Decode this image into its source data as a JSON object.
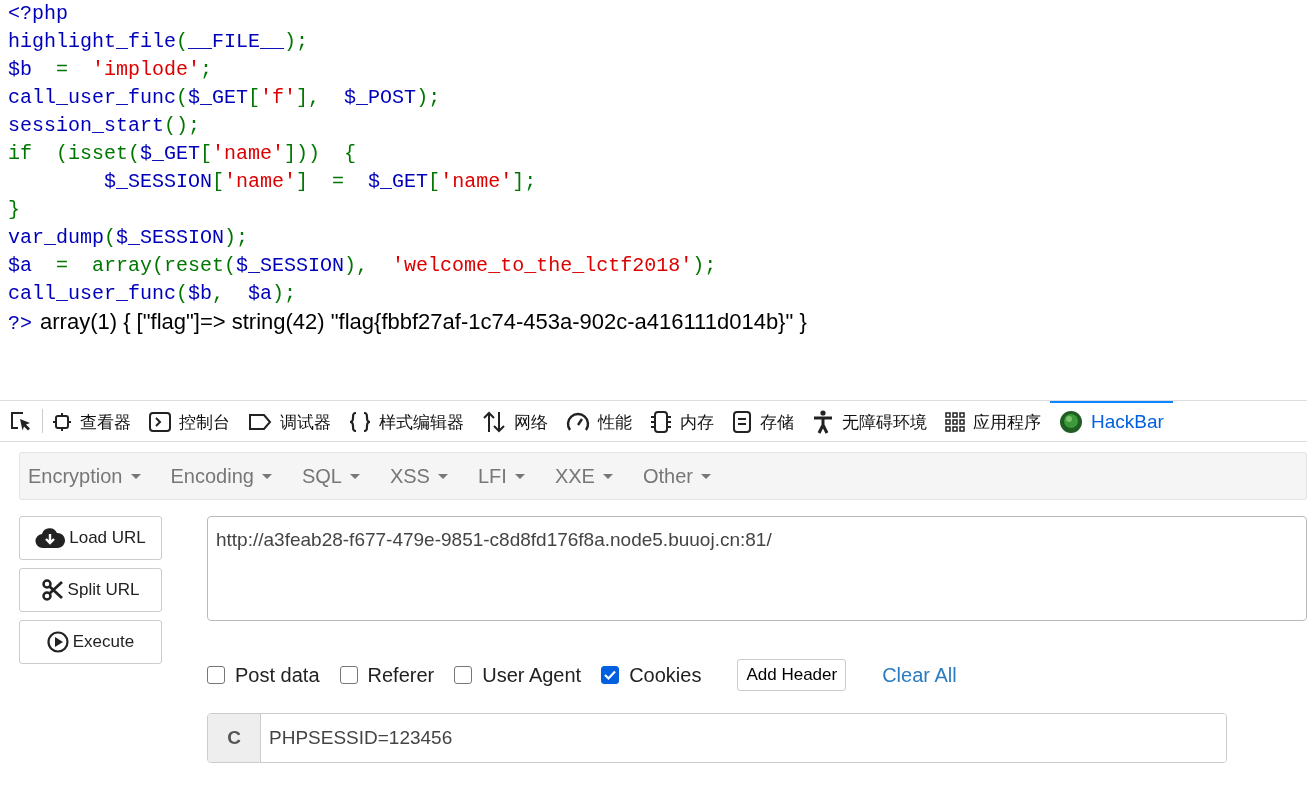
{
  "source_code": [
    [
      {
        "kind": "default",
        "text": "<?php"
      }
    ],
    [
      {
        "kind": "default",
        "text": "highlight_file"
      },
      {
        "kind": "keyword",
        "text": "("
      },
      {
        "kind": "default",
        "text": "__FILE__"
      },
      {
        "kind": "keyword",
        "text": ");"
      }
    ],
    [
      {
        "kind": "default",
        "text": "$b"
      },
      {
        "kind": "keyword",
        "text": "  =  "
      },
      {
        "kind": "string",
        "text": "'implode'"
      },
      {
        "kind": "keyword",
        "text": ";"
      }
    ],
    [
      {
        "kind": "default",
        "text": "call_user_func"
      },
      {
        "kind": "keyword",
        "text": "("
      },
      {
        "kind": "default",
        "text": "$_GET"
      },
      {
        "kind": "keyword",
        "text": "["
      },
      {
        "kind": "string",
        "text": "'f'"
      },
      {
        "kind": "keyword",
        "text": "],  "
      },
      {
        "kind": "default",
        "text": "$_POST"
      },
      {
        "kind": "keyword",
        "text": ");"
      }
    ],
    [
      {
        "kind": "default",
        "text": "session_start"
      },
      {
        "kind": "keyword",
        "text": "();"
      }
    ],
    [
      {
        "kind": "keyword",
        "text": "if  (isset("
      },
      {
        "kind": "default",
        "text": "$_GET"
      },
      {
        "kind": "keyword",
        "text": "["
      },
      {
        "kind": "string",
        "text": "'name'"
      },
      {
        "kind": "keyword",
        "text": "]))  {"
      }
    ],
    [
      {
        "kind": "default",
        "text": "        $_SESSION"
      },
      {
        "kind": "keyword",
        "text": "["
      },
      {
        "kind": "string",
        "text": "'name'"
      },
      {
        "kind": "keyword",
        "text": "]  =  "
      },
      {
        "kind": "default",
        "text": "$_GET"
      },
      {
        "kind": "keyword",
        "text": "["
      },
      {
        "kind": "string",
        "text": "'name'"
      },
      {
        "kind": "keyword",
        "text": "];"
      }
    ],
    [
      {
        "kind": "keyword",
        "text": "}"
      }
    ],
    [
      {
        "kind": "default",
        "text": "var_dump"
      },
      {
        "kind": "keyword",
        "text": "("
      },
      {
        "kind": "default",
        "text": "$_SESSION"
      },
      {
        "kind": "keyword",
        "text": ");"
      }
    ],
    [
      {
        "kind": "default",
        "text": "$a"
      },
      {
        "kind": "keyword",
        "text": "  =  array(reset("
      },
      {
        "kind": "default",
        "text": "$_SESSION"
      },
      {
        "kind": "keyword",
        "text": "),  "
      },
      {
        "kind": "string",
        "text": "'welcome_to_the_lctf2018'"
      },
      {
        "kind": "keyword",
        "text": ");"
      }
    ],
    [
      {
        "kind": "default",
        "text": "call_user_func"
      },
      {
        "kind": "keyword",
        "text": "("
      },
      {
        "kind": "default",
        "text": "$b"
      },
      {
        "kind": "keyword",
        "text": ",  "
      },
      {
        "kind": "default",
        "text": "$a"
      },
      {
        "kind": "keyword",
        "text": ");"
      }
    ],
    [
      {
        "kind": "default",
        "text": "?>"
      },
      {
        "kind": "output",
        "text": "array(1) { [\"flag\"]=> string(42) \"flag{fbbf27af-1c74-453a-902c-a416111d014b}\" }"
      }
    ]
  ],
  "devtools_tabs": [
    {
      "kind": "picker",
      "selected": false
    },
    {
      "kind": "inspector",
      "label": "查看器",
      "selected": false
    },
    {
      "kind": "console",
      "label": "控制台",
      "selected": false
    },
    {
      "kind": "debugger",
      "label": "调试器",
      "selected": false
    },
    {
      "kind": "style",
      "label": "样式编辑器",
      "selected": false
    },
    {
      "kind": "network",
      "label": "网络",
      "selected": false
    },
    {
      "kind": "performance",
      "label": "性能",
      "selected": false
    },
    {
      "kind": "memory",
      "label": "内存",
      "selected": false
    },
    {
      "kind": "storage",
      "label": "存储",
      "selected": false
    },
    {
      "kind": "accessibility",
      "label": "无障碍环境",
      "selected": false
    },
    {
      "kind": "apps",
      "label": "应用程序",
      "selected": false
    },
    {
      "kind": "hackbar",
      "label": "HackBar",
      "selected": true
    }
  ],
  "hackbar_menu": [
    "Encryption",
    "Encoding",
    "SQL",
    "XSS",
    "LFI",
    "XXE",
    "Other"
  ],
  "actions": [
    {
      "kind": "load",
      "label": "Load URL"
    },
    {
      "kind": "split",
      "label": "Split URL"
    },
    {
      "kind": "execute",
      "label": "Execute"
    }
  ],
  "url": "http://a3feab28-f677-479e-9851-c8d8fd176f8a.node5.buuoj.cn:81/",
  "options": [
    {
      "label": "Post data",
      "checked": false
    },
    {
      "label": "Referer",
      "checked": false
    },
    {
      "label": "User Agent",
      "checked": false
    },
    {
      "label": "Cookies",
      "checked": true
    }
  ],
  "add_header": "Add Header",
  "clear_all": "Clear All",
  "cookie": {
    "prefix": "C",
    "value": "PHPSESSID=123456"
  }
}
